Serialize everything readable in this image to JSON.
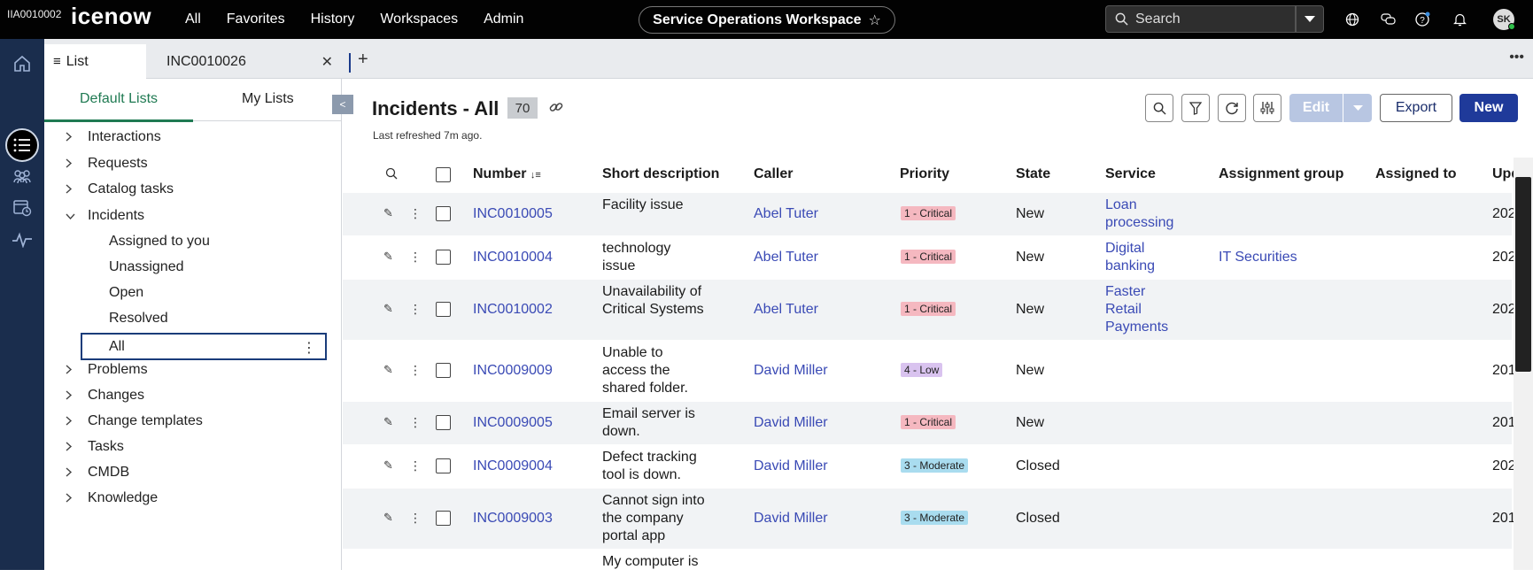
{
  "topbar": {
    "instance_id": "IIA0010002",
    "logo": "icenow",
    "nav": [
      "All",
      "Favorites",
      "History",
      "Workspaces",
      "Admin"
    ],
    "workspace": "Service Operations Workspace",
    "search_placeholder": "Search",
    "avatar_initials": "SK"
  },
  "tabs": {
    "list_label": "List",
    "record_label": "INC0010026"
  },
  "sidebar": {
    "tab_default": "Default Lists",
    "tab_mine": "My Lists",
    "items": [
      {
        "label": "Interactions",
        "type": "parent"
      },
      {
        "label": "Requests",
        "type": "parent"
      },
      {
        "label": "Catalog tasks",
        "type": "parent"
      },
      {
        "label": "Incidents",
        "type": "expanded"
      },
      {
        "label": "Assigned to you",
        "type": "child"
      },
      {
        "label": "Unassigned",
        "type": "child"
      },
      {
        "label": "Open",
        "type": "child"
      },
      {
        "label": "Resolved",
        "type": "child"
      },
      {
        "label": "All",
        "type": "selected"
      },
      {
        "label": "Problems",
        "type": "parent"
      },
      {
        "label": "Changes",
        "type": "parent"
      },
      {
        "label": "Change templates",
        "type": "parent"
      },
      {
        "label": "Tasks",
        "type": "parent"
      },
      {
        "label": "CMDB",
        "type": "parent"
      },
      {
        "label": "Knowledge",
        "type": "parent"
      }
    ]
  },
  "main": {
    "title": "Incidents - All",
    "count": "70",
    "refreshed": "Last refreshed 7m ago.",
    "edit_label": "Edit",
    "export_label": "Export",
    "new_label": "New"
  },
  "table": {
    "columns": [
      "Number",
      "Short description",
      "Caller",
      "Priority",
      "State",
      "Service",
      "Assignment group",
      "Assigned to",
      "Upd"
    ],
    "rows": [
      {
        "number": "INC0010005",
        "desc": [
          "Facility issue"
        ],
        "caller": "Abel Tuter",
        "priority": "1 - Critical",
        "state": "New",
        "service": [
          "Loan",
          "processing"
        ],
        "group": "",
        "updated": "202"
      },
      {
        "number": "INC0010004",
        "desc": [
          "technology",
          "issue"
        ],
        "caller": "Abel Tuter",
        "priority": "1 - Critical",
        "state": "New",
        "service": [
          "Digital",
          "banking"
        ],
        "group": "IT Securities",
        "updated": "202"
      },
      {
        "number": "INC0010002",
        "desc": [
          "Unavailability of",
          "Critical Systems"
        ],
        "caller": "Abel Tuter",
        "priority": "1 - Critical",
        "state": "New",
        "service": [
          "Faster",
          "Retail",
          "Payments"
        ],
        "group": "",
        "updated": "202"
      },
      {
        "number": "INC0009009",
        "desc": [
          "Unable to",
          "access the",
          "shared folder."
        ],
        "caller": "David Miller",
        "priority": "4 - Low",
        "state": "New",
        "service": [],
        "group": "",
        "updated": "201"
      },
      {
        "number": "INC0009005",
        "desc": [
          "Email server is",
          "down."
        ],
        "caller": "David Miller",
        "priority": "1 - Critical",
        "state": "New",
        "service": [],
        "group": "",
        "updated": "201"
      },
      {
        "number": "INC0009004",
        "desc": [
          "Defect tracking",
          "tool is down."
        ],
        "caller": "David Miller",
        "priority": "3 - Moderate",
        "state": "Closed",
        "service": [],
        "group": "",
        "updated": "202"
      },
      {
        "number": "INC0009003",
        "desc": [
          "Cannot sign into",
          "the company",
          "portal app"
        ],
        "caller": "David Miller",
        "priority": "3 - Moderate",
        "state": "Closed",
        "service": [],
        "group": "",
        "updated": "201"
      },
      {
        "number": "",
        "desc": [
          "My computer is"
        ],
        "caller": "",
        "priority": "",
        "state": "",
        "service": [],
        "group": "",
        "updated": ""
      }
    ]
  },
  "colors": {
    "critical": "#f5b8c0",
    "low": "#d9c3ef",
    "moderate": "#a9dcef",
    "link": "#3a4ab5",
    "primary": "#1f3a9a",
    "rail": "#1a2d4d"
  }
}
